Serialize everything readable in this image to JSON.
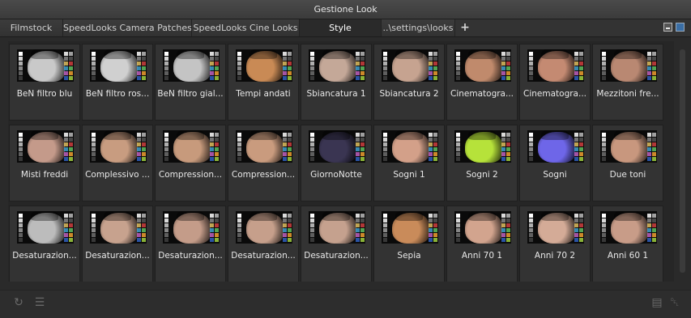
{
  "window": {
    "title": "Gestione Look"
  },
  "tabs": [
    {
      "label": "Filmstock",
      "active": false
    },
    {
      "label": "SpeedLooks Camera Patches",
      "active": false
    },
    {
      "label": "SpeedLooks Cine Looks",
      "active": false
    },
    {
      "label": "Style",
      "active": true
    },
    {
      "label": "..\\settings\\looks",
      "active": false
    }
  ],
  "toolbar": {
    "add_tab_icon": "plus-icon",
    "min_icon": "minimize-icon",
    "max_icon": "maximize-icon"
  },
  "looks": [
    {
      "label": "BeN filtro blu",
      "tint": "#c9c9c9"
    },
    {
      "label": "BeN filtro ros...",
      "tint": "#d0d0d0"
    },
    {
      "label": "BeN filtro gial...",
      "tint": "#c4c4c4"
    },
    {
      "label": "Tempi andati",
      "tint": "#c98a55"
    },
    {
      "label": "Sbiancatura 1",
      "tint": "#c4a898"
    },
    {
      "label": "Sbiancatura 2",
      "tint": "#c6a390"
    },
    {
      "label": "Cinematogra...",
      "tint": "#c08a6c"
    },
    {
      "label": "Cinematogra...",
      "tint": "#c48a72"
    },
    {
      "label": "Mezzitoni fre...",
      "tint": "#b98872"
    },
    {
      "label": "Misti freddi",
      "tint": "#c49a8a"
    },
    {
      "label": "Complessivo ...",
      "tint": "#c89c80"
    },
    {
      "label": "Compression...",
      "tint": "#c79a7c"
    },
    {
      "label": "Compression...",
      "tint": "#c99b7e"
    },
    {
      "label": "GiornoNotte",
      "tint": "#3a3552"
    },
    {
      "label": "Sogni 1",
      "tint": "#d3a089"
    },
    {
      "label": "Sogni 2",
      "tint": "#b6e23a"
    },
    {
      "label": "Sogni",
      "tint": "#6e66e8"
    },
    {
      "label": "Due toni",
      "tint": "#c8977e"
    },
    {
      "label": "Desaturazion...",
      "tint": "#bcbcbc"
    },
    {
      "label": "Desaturazion...",
      "tint": "#c7a28e"
    },
    {
      "label": "Desaturazion...",
      "tint": "#c49c89"
    },
    {
      "label": "Desaturazion...",
      "tint": "#c69f8b"
    },
    {
      "label": "Desaturazion...",
      "tint": "#c5a18e"
    },
    {
      "label": "Sepia",
      "tint": "#c98b5a"
    },
    {
      "label": "Anni 70 1",
      "tint": "#d2a48e"
    },
    {
      "label": "Anni 70 2",
      "tint": "#d4ab97"
    },
    {
      "label": "Anni 60 1",
      "tint": "#c89c88"
    }
  ],
  "bottom": {
    "left_icons": [
      "refresh-icon",
      "list-settings-icon"
    ],
    "right_icons": [
      "folder-move-icon",
      "trash-icon"
    ]
  }
}
